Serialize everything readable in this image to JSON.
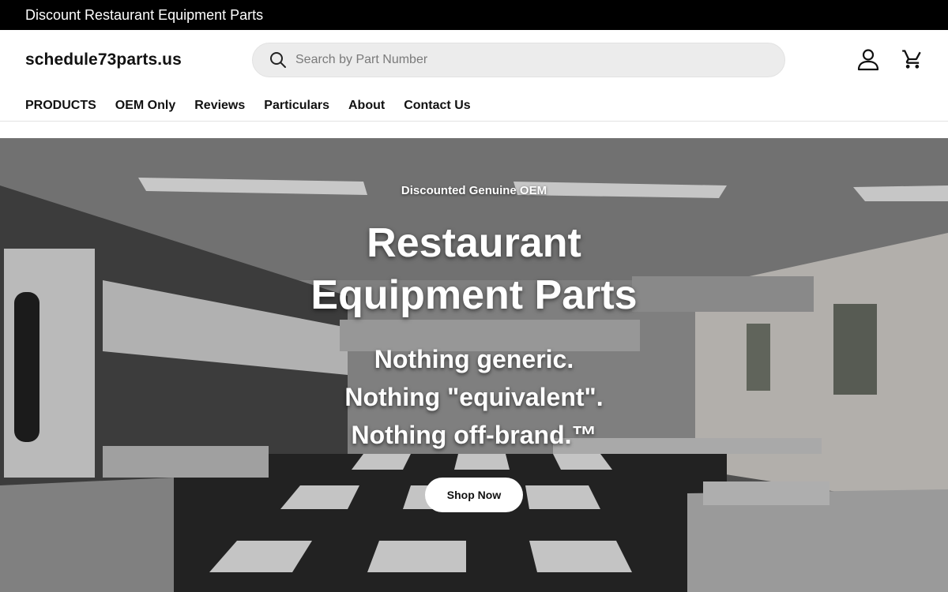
{
  "announcement": "Discount Restaurant Equipment Parts",
  "header": {
    "logo": "schedule73parts.us",
    "search_placeholder": "Search by Part Number"
  },
  "icons": {
    "search": "search-icon",
    "account": "account-icon",
    "cart": "cart-icon"
  },
  "nav": [
    "PRODUCTS",
    "OEM Only",
    "Reviews",
    "Particulars",
    "About",
    "Contact Us"
  ],
  "hero": {
    "kicker": "Discounted Genuine OEM",
    "headline": [
      "Restaurant",
      "Equipment Parts"
    ],
    "tagline": [
      "Nothing generic.",
      "Nothing \"equivalent\".",
      "Nothing off-brand.™"
    ],
    "button": "Shop Now"
  }
}
